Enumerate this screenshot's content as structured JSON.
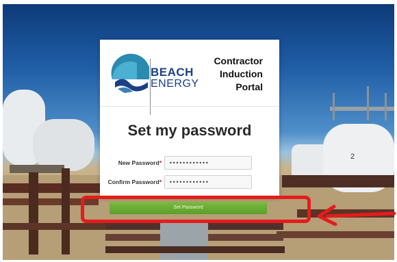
{
  "portal": {
    "brand_line_1": "BEACH",
    "brand_line_2": "ENERGY",
    "title_lines": [
      "Contractor",
      "Induction",
      "Portal"
    ]
  },
  "form": {
    "heading": "Set my password",
    "new_password_label": "New Password",
    "confirm_password_label": "Confirm Password",
    "required_mark": "*",
    "new_password_value": "••••••••••••",
    "confirm_password_value": "••••••••••••",
    "submit_label": "Set Password"
  },
  "colors": {
    "brand_blue": "#1b3f86",
    "button_green": "#6aad34",
    "highlight_red": "#e51c1c"
  },
  "annotation": {
    "highlight_target": "set-password-button",
    "arrow_direction": "left"
  }
}
